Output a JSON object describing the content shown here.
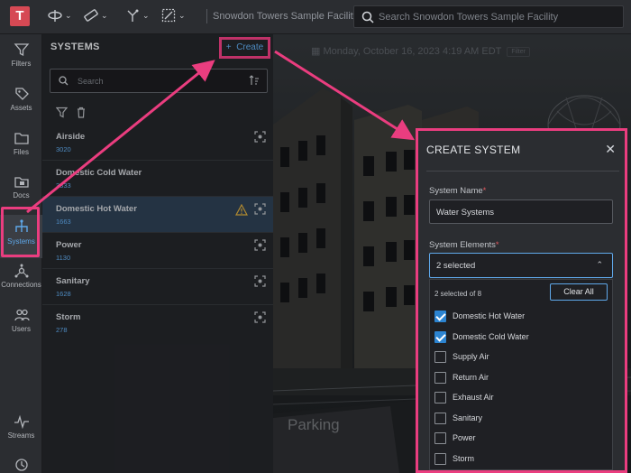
{
  "app": {
    "logo_letter": "T",
    "facility_name": "Snowdon Towers Sample Facility"
  },
  "search": {
    "placeholder": "Search Snowdon Towers Sample Facility"
  },
  "toolbar": {
    "tools": [
      "orbit-icon",
      "measure-icon",
      "section-icon",
      "selection-box-icon"
    ]
  },
  "rail": {
    "items": [
      {
        "label": "Filters",
        "icon": "filter-icon"
      },
      {
        "label": "Assets",
        "icon": "tag-icon"
      },
      {
        "label": "Files",
        "icon": "folder-icon"
      },
      {
        "label": "Docs",
        "icon": "docs-icon"
      },
      {
        "label": "Systems",
        "icon": "systems-icon",
        "active": true
      },
      {
        "label": "Connections",
        "icon": "connections-icon"
      },
      {
        "label": "Users",
        "icon": "users-icon"
      },
      {
        "label": "Streams",
        "icon": "streams-icon"
      }
    ]
  },
  "systems_panel": {
    "title": "SYSTEMS",
    "create_label": "Create",
    "search_placeholder": "Search",
    "systems": [
      {
        "name": "Airside",
        "id": "3020"
      },
      {
        "name": "Domestic Cold Water",
        "id": "3333"
      },
      {
        "name": "Domestic Hot Water",
        "id": "1663",
        "selected": true,
        "warning": true
      },
      {
        "name": "Power",
        "id": "1130"
      },
      {
        "name": "Sanitary",
        "id": "1628"
      },
      {
        "name": "Storm",
        "id": "278"
      }
    ]
  },
  "viewport": {
    "date_text": "Monday, October 16, 2023 4:19 AM EDT",
    "filter_chip": "Filter",
    "sign_text": "Parking"
  },
  "dialog": {
    "title": "CREATE SYSTEM",
    "name_label": "System Name",
    "name_value": "Water Systems",
    "elements_label": "System Elements",
    "elements_value": "2 selected",
    "selected_count": "2 selected of 8",
    "clear_all_label": "Clear All",
    "options": [
      {
        "label": "Domestic Hot Water",
        "checked": true
      },
      {
        "label": "Domestic Cold Water",
        "checked": true
      },
      {
        "label": "Supply Air",
        "checked": false
      },
      {
        "label": "Return Air",
        "checked": false
      },
      {
        "label": "Exhaust Air",
        "checked": false
      },
      {
        "label": "Sanitary",
        "checked": false
      },
      {
        "label": "Power",
        "checked": false
      },
      {
        "label": "Storm",
        "checked": false
      }
    ]
  },
  "colors": {
    "accent": "#5fa8ea",
    "annotation": "#ea3d7f",
    "brand": "#d64954"
  }
}
